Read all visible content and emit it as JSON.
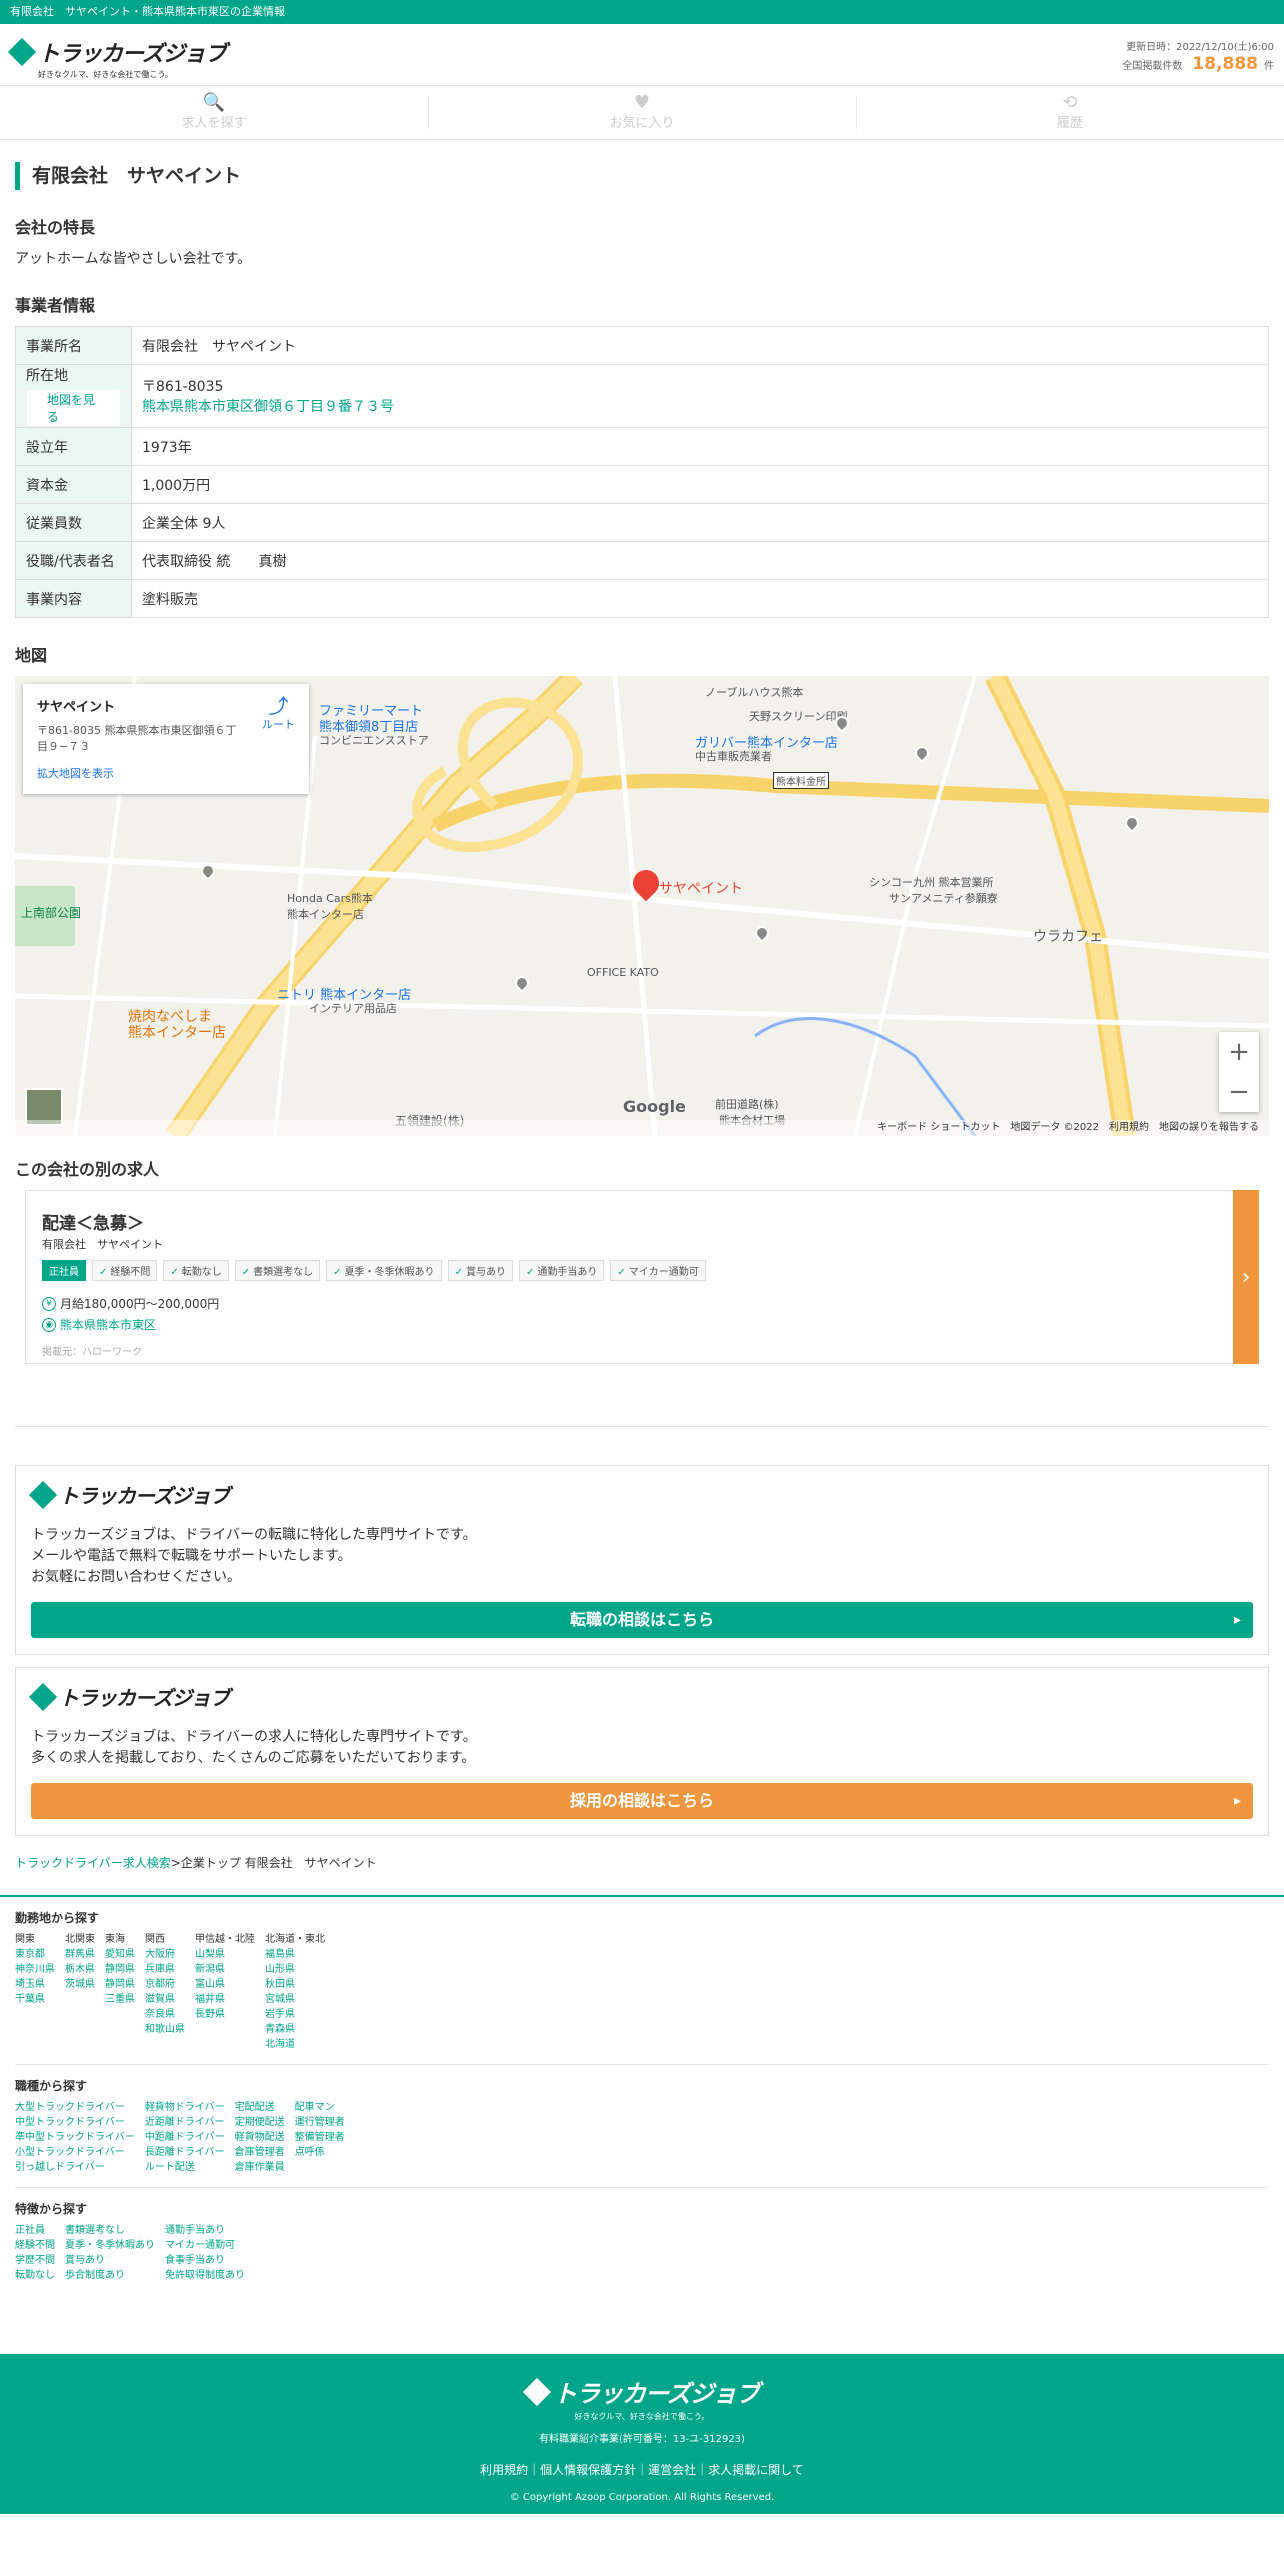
{
  "topbar": {
    "text": "有限会社　サヤペイント・熊本県熊本市東区の企業情報"
  },
  "header": {
    "logo_text": "トラッカーズジョブ",
    "logo_sub": "好きなクルマ、好きな会社で働こう。",
    "updated": "更新日時：2022/12/10(土)6:00",
    "count_label": "全国掲載件数",
    "count": "18,888",
    "count_unit": "件"
  },
  "nav": [
    {
      "label": "求人を探す",
      "icon": "🔍"
    },
    {
      "label": "お気に入り",
      "icon": "♥"
    },
    {
      "label": "履歴",
      "icon": "⟲"
    }
  ],
  "company": {
    "name": "有限会社　サヤペイント",
    "feature_heading": "会社の特長",
    "feature_text": "アットホームな皆やさしい会社です。",
    "info_heading": "事業者情報",
    "rows": [
      {
        "label": "事業所名",
        "value": "有限会社　サヤペイント"
      },
      {
        "label": "設立年",
        "value": "1973年"
      },
      {
        "label": "資本金",
        "value": "1,000万円"
      },
      {
        "label": "従業員数",
        "value": "企業全体 9人"
      },
      {
        "label": "役職/代表者名",
        "value": "代表取締役 統　　真樹"
      },
      {
        "label": "事業内容",
        "value": "塗料販売"
      }
    ],
    "address_label": "所在地",
    "map_button": "地図を見る",
    "zip": "〒861-8035",
    "address": "熊本県熊本市東区御領６丁目９番７３号"
  },
  "map": {
    "heading": "地図",
    "card_name": "サヤペイント",
    "card_address": "〒861-8035 熊本県熊本市東区御領６丁目９−７３",
    "route": "ルート",
    "enlarge": "拡大地図を表示",
    "pin_label": "サヤペイント",
    "labels": [
      "ファミリーマート",
      "熊本御領8丁目店",
      "コンビニエンスストア",
      "ガリバー熊本インター店",
      "中古車販売業者",
      "熊本料金所",
      "ニトリ 熊本インター店",
      "インテリア用品店",
      "焼肉なべしま",
      "熊本インター店",
      "ウラカフェ",
      "シンコー九州 熊本営業所",
      "サンアメニティ参願寮",
      "OFFICE KATO",
      "前田道路(株)",
      "熊本合材工場",
      "上南部公園",
      "Honda Cars熊本",
      "熊本インター店",
      "五領建設(株)",
      "ノーブルハウス熊本",
      "天野スクリーン印刷"
    ],
    "google": "Google",
    "footer": "キーボード ショートカット　地図データ ©2022　利用規約　地図の誤りを報告する"
  },
  "jobs": {
    "heading": "この会社の別の求人",
    "items": [
      {
        "title": "配達＜急募＞",
        "company": "有限会社　サヤペイント",
        "tags": [
          "正社員",
          "経験不問",
          "転勤なし",
          "書類選考なし",
          "夏季・冬季休暇あり",
          "賞与あり",
          "通勤手当あり",
          "マイカー通勤可"
        ],
        "salary": "月給180,000円〜200,000円",
        "location": "熊本県熊本市東区",
        "source": "掲載元：ハローワーク"
      }
    ]
  },
  "promos": [
    {
      "text1": "トラッカーズジョブは、ドライバーの転職に特化した専門サイトです。",
      "text2": "メールや電話で無料で転職をサポートいたします。",
      "text3": "お気軽にお問い合わせください。",
      "button": "転職の相談はこちら"
    },
    {
      "text1": "トラッカーズジョブは、ドライバーの求人に特化した専門サイトです。",
      "text2": "多くの求人を掲載しており、たくさんのご応募をいただいております。",
      "text3": "",
      "button": "採用の相談はこちら"
    }
  ],
  "breadcrumb": {
    "link": "トラックドライバー求人検索",
    "rest": ">企業トップ 有限会社　サヤペイント"
  },
  "area_search": {
    "heading": "勤務地から探す",
    "cols": [
      {
        "cat": "関東",
        "items": [
          "東京都",
          "神奈川県",
          "埼玉県",
          "千葉県"
        ]
      },
      {
        "cat": "北関東",
        "items": [
          "群馬県",
          "栃木県",
          "茨城県"
        ]
      },
      {
        "cat": "東海",
        "items": [
          "愛知県",
          "静岡県",
          "静岡県",
          "三重県"
        ]
      },
      {
        "cat": "関西",
        "items": [
          "大阪府",
          "兵庫県",
          "京都府",
          "滋賀県",
          "奈良県",
          "和歌山県"
        ]
      },
      {
        "cat": "甲信越・北陸",
        "items": [
          "山梨県",
          "新潟県",
          "富山県",
          "福井県",
          "長野県"
        ]
      },
      {
        "cat": "北海道・東北",
        "items": [
          "福島県",
          "山形県",
          "秋田県",
          "宮城県",
          "岩手県",
          "青森県",
          "北海道"
        ]
      }
    ]
  },
  "job_search": {
    "heading": "職種から探す",
    "cols": [
      [
        "大型トラックドライバー",
        "中型トラックドライバー",
        "準中型トラックドライバー",
        "小型トラックドライバー",
        "引っ越しドライバー"
      ],
      [
        "軽貨物ドライバー",
        "近距離ドライバー",
        "中距離ドライバー",
        "長距離ドライバー",
        "ルート配送"
      ],
      [
        "宅配配送",
        "定期便配送",
        "軽貨物配送",
        "倉庫管理者",
        "倉庫作業員"
      ],
      [
        "配車マン",
        "運行管理者",
        "整備管理者",
        "点呼係"
      ]
    ]
  },
  "feature_search": {
    "heading": "特徴から探す",
    "cols": [
      [
        "正社員",
        "経験不問",
        "学歴不問",
        "転勤なし"
      ],
      [
        "書類選考なし",
        "夏季・冬季休暇あり",
        "賞与あり",
        "歩合制度あり"
      ],
      [
        "通勤手当あり",
        "マイカー通勤可",
        "食事手当あり",
        "免許取得制度あり"
      ]
    ]
  },
  "footer": {
    "logo_text": "トラッカーズジョブ",
    "logo_sub": "好きなクルマ、好きな会社で働こう。",
    "license": "有料職業紹介事業(許可番号：13-ユ-312923)",
    "links": "利用規約｜個人情報保護方針｜運営会社｜求人掲載に関して",
    "copyright": "© Copyright Azoop Corporation. All Rights Reserved."
  },
  "colors": {
    "brand": "#00a58a",
    "accent": "#f0963c"
  }
}
